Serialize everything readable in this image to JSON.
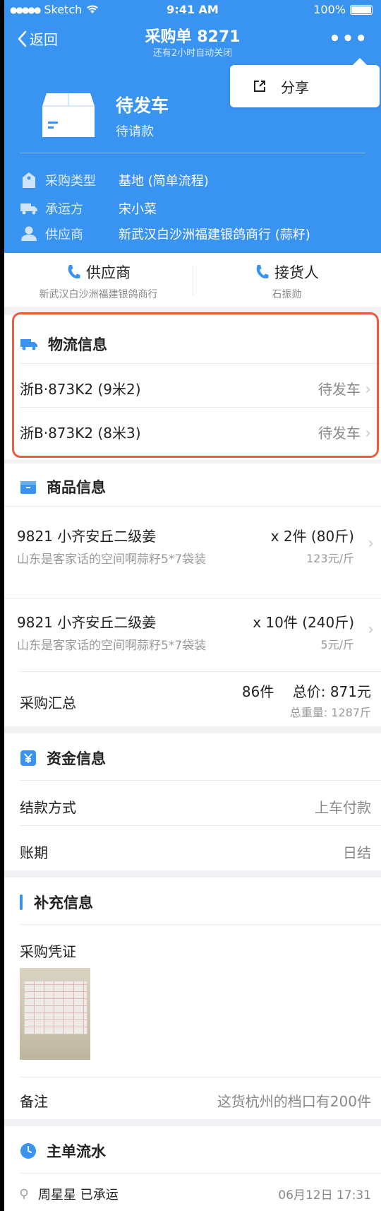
{
  "status_bar": {
    "carrier": "Sketch",
    "time": "9:41 AM",
    "battery": "100%"
  },
  "nav": {
    "back_label": "返回",
    "title": "采购单 8271",
    "subtitle": "还有2小时自动关闭"
  },
  "share_menu": {
    "label": "分享"
  },
  "order_status": {
    "title": "待发车",
    "subtitle": "待请款"
  },
  "order_info": [
    {
      "label": "采购类型",
      "value": "基地 (简单流程)",
      "icon": "tag-icon"
    },
    {
      "label": "承运方",
      "value": "宋小菜",
      "icon": "truck-icon"
    },
    {
      "label": "供应商",
      "value": "新武汉白沙洲福建银鸽商行 (蒜籽)",
      "icon": "person-icon"
    }
  ],
  "contacts": [
    {
      "title": "供应商",
      "subtitle": "新武汉白沙洲福建银鸽商行",
      "icon": "phone-icon"
    },
    {
      "title": "接货人",
      "subtitle": "石振勋",
      "icon": "phone-icon"
    }
  ],
  "logistics": {
    "title": "物流信息",
    "items": [
      {
        "plate": "浙B·873K2 (9米2)",
        "status": "待发车"
      },
      {
        "plate": "浙B·873K2 (8米3)",
        "status": "待发车"
      }
    ]
  },
  "goods": {
    "title": "商品信息",
    "items": [
      {
        "name": "9821 小齐安丘二级姜",
        "spec": "山东是客家话的空间啊蒜籽5*7袋装",
        "qty": "x 2件 (80斤)",
        "unit_price": "123元/斤"
      },
      {
        "name": "9821 小齐安丘二级姜",
        "spec": "山东是客家话的空间啊蒜籽5*7袋装",
        "qty": "x 10件 (240斤)",
        "unit_price": "5元/斤"
      }
    ],
    "summary": {
      "label": "采购汇总",
      "count": "86件",
      "total": "总价: 871元",
      "weight": "总重量: 1287斤"
    }
  },
  "funds": {
    "title": "资金信息",
    "rows": [
      {
        "label": "结款方式",
        "value": "上车付款"
      },
      {
        "label": "账期",
        "value": "日结"
      }
    ]
  },
  "extra": {
    "title": "补充信息",
    "voucher_label": "采购凭证",
    "remark_label": "备注",
    "remark_value": "这货杭州的档口有200件"
  },
  "flow": {
    "title": "主单流水",
    "items": [
      {
        "text": "周星星 已承运",
        "time": "06月12日 17:31"
      }
    ]
  },
  "colors": {
    "primary": "#3994f1",
    "highlight": "#f05a3c"
  }
}
